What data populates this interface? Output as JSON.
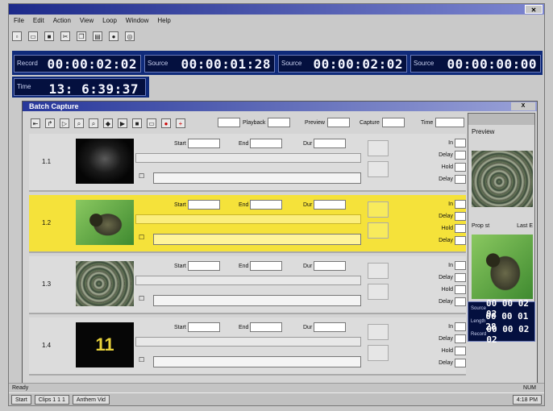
{
  "app": {
    "title": "",
    "menu": [
      "File",
      "Edit",
      "Action",
      "View",
      "Loop",
      "Window",
      "Help"
    ]
  },
  "toolbar_icons": [
    "new-icon",
    "open-icon",
    "save-icon",
    "cut-icon",
    "copy-icon",
    "paste-icon",
    "delete-icon",
    "settings-icon"
  ],
  "timecodes": [
    {
      "label": "Record",
      "value": "00:00:02:02"
    },
    {
      "label": "Source",
      "value": "00:00:01:28"
    },
    {
      "label": "Source",
      "value": "00:00:02:02"
    },
    {
      "label": "Source",
      "value": "00:00:00:00"
    }
  ],
  "clock": {
    "label": "Time",
    "value": "13: 6:39:37"
  },
  "dialog": {
    "title": "Batch Capture",
    "close_label": "X",
    "fields": {
      "playback_label": "Playback",
      "preview_label": "Preview",
      "capture_label": "Capture",
      "time_label": "Time"
    }
  },
  "clip_labels": {
    "start": "Start",
    "end": "End",
    "dur": "Dur",
    "in": "In",
    "delay": "Delay",
    "hold": "Hold"
  },
  "clips": [
    {
      "num": "1.1",
      "selected": false,
      "thumb": "black"
    },
    {
      "num": "1.2",
      "selected": true,
      "thumb": "turtle"
    },
    {
      "num": "1.3",
      "selected": false,
      "thumb": "rocks"
    },
    {
      "num": "1.4",
      "selected": false,
      "thumb": "eleven"
    }
  ],
  "preview": {
    "title": "Preview",
    "prop_label": "Prop st",
    "last_label": "Last E",
    "mini_tc": [
      {
        "label": "Source",
        "value": "00 00 02 02"
      },
      {
        "label": "Length",
        "value": "00 00 01 28"
      },
      {
        "label": "Record",
        "value": "00 00 02 02"
      }
    ]
  },
  "statusbar": {
    "left": "Ready",
    "right": "NUM"
  },
  "taskbar": {
    "start": "Start",
    "items": [
      "Clips 1 1 1",
      "Anthem Vid"
    ],
    "clock": "4:18 PM"
  }
}
